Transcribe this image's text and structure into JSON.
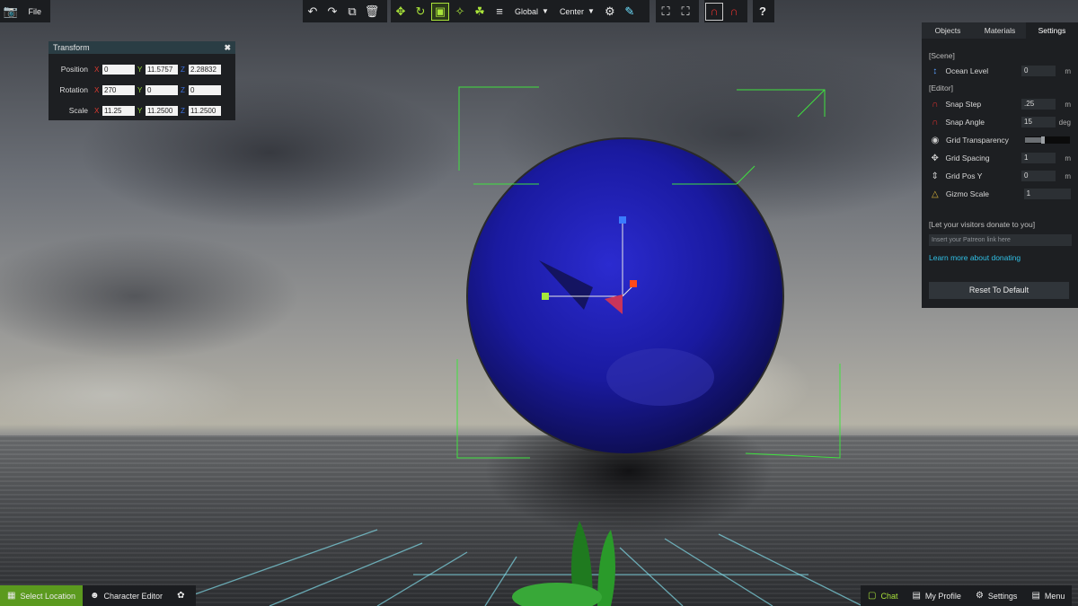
{
  "toolbar": {
    "camera_icon": "camera-icon",
    "file_label": "File",
    "space_select": "Global",
    "pivot_select": "Center"
  },
  "transform": {
    "title": "Transform",
    "rows": [
      {
        "label": "Position",
        "x": "0",
        "y": "11.5757",
        "z": "2.28832"
      },
      {
        "label": "Rotation",
        "x": "270",
        "y": "0",
        "z": "0"
      },
      {
        "label": "Scale",
        "x": "11.25",
        "y": "11.2500",
        "z": "11.2500"
      }
    ],
    "axis_x": "X",
    "axis_y": "Y",
    "axis_z": "Z"
  },
  "panel": {
    "tabs": [
      "Objects",
      "Materials",
      "Settings"
    ],
    "active_tab": "Settings",
    "scene_header": "[Scene]",
    "ocean_label": "Ocean Level",
    "ocean_value": "0",
    "ocean_unit": "m",
    "editor_header": "[Editor]",
    "snap_step_label": "Snap Step",
    "snap_step_value": ".25",
    "snap_step_unit": "m",
    "snap_angle_label": "Snap Angle",
    "snap_angle_value": "15",
    "snap_angle_unit": "deg",
    "grid_transparency_label": "Grid Transparency",
    "grid_transparency_level": 0.4,
    "grid_spacing_label": "Grid Spacing",
    "grid_spacing_value": "1",
    "grid_spacing_unit": "m",
    "grid_pos_label": "Grid Pos Y",
    "grid_pos_value": "0",
    "grid_pos_unit": "m",
    "gizmo_label": "Gizmo Scale",
    "gizmo_value": "1",
    "donate_header": "[Let your visitors donate to you]",
    "patreon_placeholder": "Insert your Patreon link here",
    "donate_link": "Learn more about donating",
    "reset_label": "Reset To Default"
  },
  "bottom": {
    "select_location": "Select Location",
    "character_editor": "Character Editor",
    "chat": "Chat",
    "my_profile": "My Profile",
    "settings": "Settings",
    "menu": "Menu"
  },
  "colors": {
    "accent_green": "#a9e33a",
    "magnet_red": "#e0312f",
    "link_blue": "#31c0e6",
    "sphere_blue": "#1a1a9a"
  }
}
